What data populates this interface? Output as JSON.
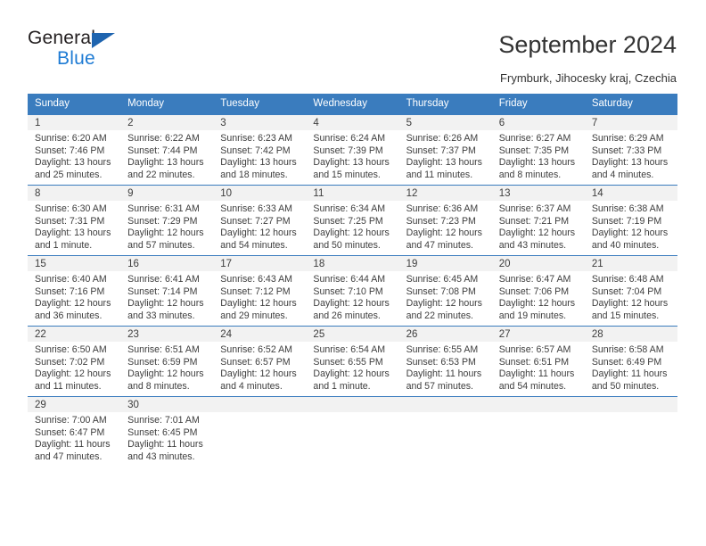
{
  "brand": {
    "name_top": "General",
    "name_bottom": "Blue",
    "accent_color": "#1e7bd4",
    "triangle_color": "#1e64af",
    "triangle_icon": "triangle-flag-icon"
  },
  "header": {
    "title": "September 2024",
    "subtitle": "Frymburk, Jihocesky kraj, Czechia"
  },
  "calendar": {
    "header_bg": "#3a7cbe",
    "daynum_bg": "#f2f2f2",
    "weekday_headers": [
      "Sunday",
      "Monday",
      "Tuesday",
      "Wednesday",
      "Thursday",
      "Friday",
      "Saturday"
    ],
    "weeks": [
      [
        {
          "day": "1",
          "sunrise": "Sunrise: 6:20 AM",
          "sunset": "Sunset: 7:46 PM",
          "daylight_1": "Daylight: 13 hours",
          "daylight_2": "and 25 minutes."
        },
        {
          "day": "2",
          "sunrise": "Sunrise: 6:22 AM",
          "sunset": "Sunset: 7:44 PM",
          "daylight_1": "Daylight: 13 hours",
          "daylight_2": "and 22 minutes."
        },
        {
          "day": "3",
          "sunrise": "Sunrise: 6:23 AM",
          "sunset": "Sunset: 7:42 PM",
          "daylight_1": "Daylight: 13 hours",
          "daylight_2": "and 18 minutes."
        },
        {
          "day": "4",
          "sunrise": "Sunrise: 6:24 AM",
          "sunset": "Sunset: 7:39 PM",
          "daylight_1": "Daylight: 13 hours",
          "daylight_2": "and 15 minutes."
        },
        {
          "day": "5",
          "sunrise": "Sunrise: 6:26 AM",
          "sunset": "Sunset: 7:37 PM",
          "daylight_1": "Daylight: 13 hours",
          "daylight_2": "and 11 minutes."
        },
        {
          "day": "6",
          "sunrise": "Sunrise: 6:27 AM",
          "sunset": "Sunset: 7:35 PM",
          "daylight_1": "Daylight: 13 hours",
          "daylight_2": "and 8 minutes."
        },
        {
          "day": "7",
          "sunrise": "Sunrise: 6:29 AM",
          "sunset": "Sunset: 7:33 PM",
          "daylight_1": "Daylight: 13 hours",
          "daylight_2": "and 4 minutes."
        }
      ],
      [
        {
          "day": "8",
          "sunrise": "Sunrise: 6:30 AM",
          "sunset": "Sunset: 7:31 PM",
          "daylight_1": "Daylight: 13 hours",
          "daylight_2": "and 1 minute."
        },
        {
          "day": "9",
          "sunrise": "Sunrise: 6:31 AM",
          "sunset": "Sunset: 7:29 PM",
          "daylight_1": "Daylight: 12 hours",
          "daylight_2": "and 57 minutes."
        },
        {
          "day": "10",
          "sunrise": "Sunrise: 6:33 AM",
          "sunset": "Sunset: 7:27 PM",
          "daylight_1": "Daylight: 12 hours",
          "daylight_2": "and 54 minutes."
        },
        {
          "day": "11",
          "sunrise": "Sunrise: 6:34 AM",
          "sunset": "Sunset: 7:25 PM",
          "daylight_1": "Daylight: 12 hours",
          "daylight_2": "and 50 minutes."
        },
        {
          "day": "12",
          "sunrise": "Sunrise: 6:36 AM",
          "sunset": "Sunset: 7:23 PM",
          "daylight_1": "Daylight: 12 hours",
          "daylight_2": "and 47 minutes."
        },
        {
          "day": "13",
          "sunrise": "Sunrise: 6:37 AM",
          "sunset": "Sunset: 7:21 PM",
          "daylight_1": "Daylight: 12 hours",
          "daylight_2": "and 43 minutes."
        },
        {
          "day": "14",
          "sunrise": "Sunrise: 6:38 AM",
          "sunset": "Sunset: 7:19 PM",
          "daylight_1": "Daylight: 12 hours",
          "daylight_2": "and 40 minutes."
        }
      ],
      [
        {
          "day": "15",
          "sunrise": "Sunrise: 6:40 AM",
          "sunset": "Sunset: 7:16 PM",
          "daylight_1": "Daylight: 12 hours",
          "daylight_2": "and 36 minutes."
        },
        {
          "day": "16",
          "sunrise": "Sunrise: 6:41 AM",
          "sunset": "Sunset: 7:14 PM",
          "daylight_1": "Daylight: 12 hours",
          "daylight_2": "and 33 minutes."
        },
        {
          "day": "17",
          "sunrise": "Sunrise: 6:43 AM",
          "sunset": "Sunset: 7:12 PM",
          "daylight_1": "Daylight: 12 hours",
          "daylight_2": "and 29 minutes."
        },
        {
          "day": "18",
          "sunrise": "Sunrise: 6:44 AM",
          "sunset": "Sunset: 7:10 PM",
          "daylight_1": "Daylight: 12 hours",
          "daylight_2": "and 26 minutes."
        },
        {
          "day": "19",
          "sunrise": "Sunrise: 6:45 AM",
          "sunset": "Sunset: 7:08 PM",
          "daylight_1": "Daylight: 12 hours",
          "daylight_2": "and 22 minutes."
        },
        {
          "day": "20",
          "sunrise": "Sunrise: 6:47 AM",
          "sunset": "Sunset: 7:06 PM",
          "daylight_1": "Daylight: 12 hours",
          "daylight_2": "and 19 minutes."
        },
        {
          "day": "21",
          "sunrise": "Sunrise: 6:48 AM",
          "sunset": "Sunset: 7:04 PM",
          "daylight_1": "Daylight: 12 hours",
          "daylight_2": "and 15 minutes."
        }
      ],
      [
        {
          "day": "22",
          "sunrise": "Sunrise: 6:50 AM",
          "sunset": "Sunset: 7:02 PM",
          "daylight_1": "Daylight: 12 hours",
          "daylight_2": "and 11 minutes."
        },
        {
          "day": "23",
          "sunrise": "Sunrise: 6:51 AM",
          "sunset": "Sunset: 6:59 PM",
          "daylight_1": "Daylight: 12 hours",
          "daylight_2": "and 8 minutes."
        },
        {
          "day": "24",
          "sunrise": "Sunrise: 6:52 AM",
          "sunset": "Sunset: 6:57 PM",
          "daylight_1": "Daylight: 12 hours",
          "daylight_2": "and 4 minutes."
        },
        {
          "day": "25",
          "sunrise": "Sunrise: 6:54 AM",
          "sunset": "Sunset: 6:55 PM",
          "daylight_1": "Daylight: 12 hours",
          "daylight_2": "and 1 minute."
        },
        {
          "day": "26",
          "sunrise": "Sunrise: 6:55 AM",
          "sunset": "Sunset: 6:53 PM",
          "daylight_1": "Daylight: 11 hours",
          "daylight_2": "and 57 minutes."
        },
        {
          "day": "27",
          "sunrise": "Sunrise: 6:57 AM",
          "sunset": "Sunset: 6:51 PM",
          "daylight_1": "Daylight: 11 hours",
          "daylight_2": "and 54 minutes."
        },
        {
          "day": "28",
          "sunrise": "Sunrise: 6:58 AM",
          "sunset": "Sunset: 6:49 PM",
          "daylight_1": "Daylight: 11 hours",
          "daylight_2": "and 50 minutes."
        }
      ],
      [
        {
          "day": "29",
          "sunrise": "Sunrise: 7:00 AM",
          "sunset": "Sunset: 6:47 PM",
          "daylight_1": "Daylight: 11 hours",
          "daylight_2": "and 47 minutes."
        },
        {
          "day": "30",
          "sunrise": "Sunrise: 7:01 AM",
          "sunset": "Sunset: 6:45 PM",
          "daylight_1": "Daylight: 11 hours",
          "daylight_2": "and 43 minutes."
        },
        {
          "day": "",
          "sunrise": "",
          "sunset": "",
          "daylight_1": "",
          "daylight_2": ""
        },
        {
          "day": "",
          "sunrise": "",
          "sunset": "",
          "daylight_1": "",
          "daylight_2": ""
        },
        {
          "day": "",
          "sunrise": "",
          "sunset": "",
          "daylight_1": "",
          "daylight_2": ""
        },
        {
          "day": "",
          "sunrise": "",
          "sunset": "",
          "daylight_1": "",
          "daylight_2": ""
        },
        {
          "day": "",
          "sunrise": "",
          "sunset": "",
          "daylight_1": "",
          "daylight_2": ""
        }
      ]
    ]
  }
}
